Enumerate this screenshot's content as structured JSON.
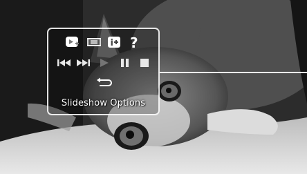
{
  "panel": {
    "title": "Slideshow Options"
  },
  "tabs": [
    {
      "icon": "slideshow-add-icon",
      "active": true
    },
    {
      "icon": "filmstrip-icon",
      "active": false
    },
    {
      "icon": "info-icon",
      "active": false
    },
    {
      "icon": "help-icon",
      "active": false
    }
  ],
  "controls": [
    {
      "icon": "previous-icon"
    },
    {
      "icon": "next-icon"
    },
    {
      "icon": "play-icon",
      "dimmed": true
    },
    {
      "icon": "pause-icon"
    },
    {
      "icon": "stop-icon"
    }
  ],
  "repeat": {
    "icon": "repeat-icon"
  },
  "colors": {
    "panel_border": "#ffffff",
    "icon_white": "#ffffff",
    "icon_dim": "#808080"
  }
}
